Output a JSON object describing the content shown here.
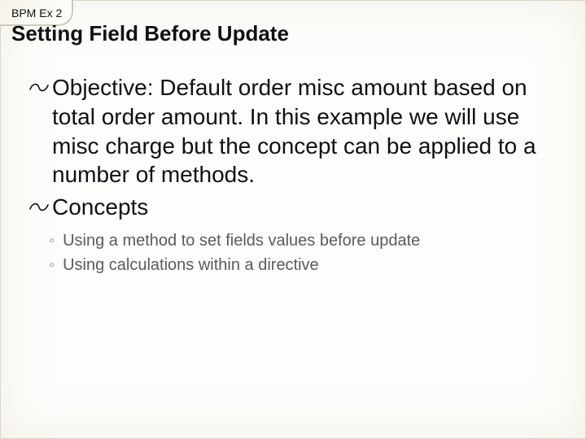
{
  "header": {
    "kicker": "BPM Ex 2",
    "title": "Setting Field Before Update"
  },
  "body": {
    "objective_label": "Objective:",
    "objective_text": "Default order misc amount based on total order amount.  In this example we will use misc charge but the concept can be applied to a number of methods.",
    "concepts_label": "Concepts",
    "sub_items": [
      "Using a method to set fields values before update",
      "Using calculations within a directive"
    ]
  }
}
